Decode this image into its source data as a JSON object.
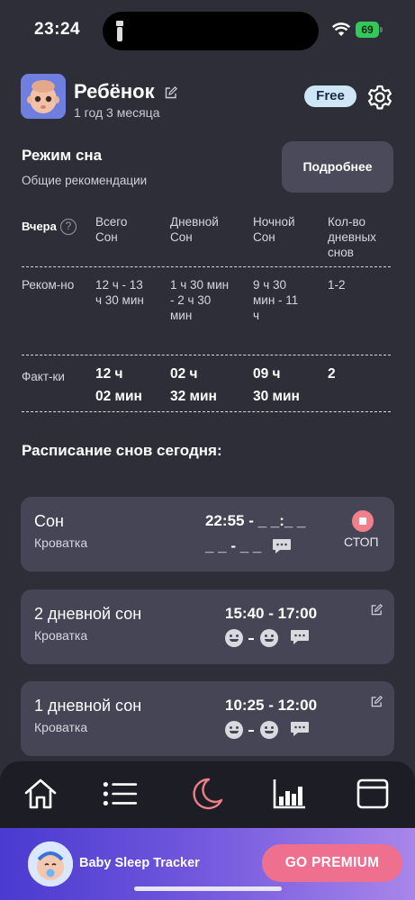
{
  "status": {
    "time": "23:24",
    "battery": "69"
  },
  "child": {
    "name": "Ребёнок",
    "age": "1 год 3 месяца",
    "plan": "Free"
  },
  "sleep_mode": {
    "title": "Режим сна",
    "subtitle": "Общие рекомендации",
    "details_button": "Подробнее"
  },
  "table": {
    "row_label_header": "Вчера",
    "help": "?",
    "columns": [
      [
        "Всего",
        "Сон"
      ],
      [
        "Дневной",
        "Сон"
      ],
      [
        "Ночной",
        "Сон"
      ],
      [
        "Кол-во",
        "дневных",
        "снов"
      ]
    ],
    "recommended": {
      "label": "Реком-но",
      "values": [
        [
          "12 ч - 13",
          "ч 30 мин"
        ],
        [
          "1 ч 30 мин",
          "- 2 ч 30",
          "мин"
        ],
        [
          "9 ч 30",
          "мин - 11",
          "ч"
        ],
        [
          "1-2"
        ]
      ]
    },
    "actual": {
      "label": "Факт-ки",
      "values": [
        [
          "12 ч",
          "02 мин"
        ],
        [
          "02 ч",
          "32 мин"
        ],
        [
          "09 ч",
          "30 мин"
        ],
        [
          "2"
        ]
      ]
    }
  },
  "schedule": {
    "title": "Расписание снов сегодня:",
    "cards": [
      {
        "title": "Сон",
        "place": "Кроватка",
        "time_line1": "22:55 - _ _:_ _",
        "time_line2": "_ _ - _ _",
        "stop_label": "СТОП"
      },
      {
        "title": "2 дневной сон",
        "place": "Кроватка",
        "time": "15:40 - 17:00"
      },
      {
        "title": "1 дневной сон",
        "place": "Кроватка",
        "time": "10:25 - 12:00"
      }
    ]
  },
  "tabs": [
    "home-icon",
    "list-icon",
    "moon-icon",
    "stats-icon",
    "calendar-icon"
  ],
  "promo": {
    "app_name": "Baby Sleep Tracker",
    "button": "GO PREMIUM"
  },
  "colors": {
    "accent": "#ef6f8f",
    "background": "#2e2e39",
    "card": "#454556"
  }
}
